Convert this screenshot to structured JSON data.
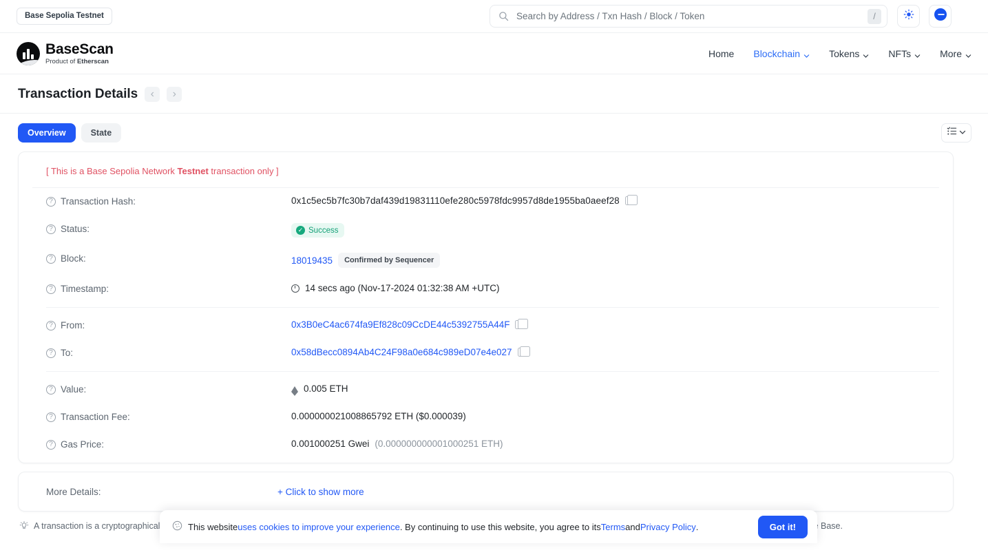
{
  "topbar": {
    "network_pill": "Base Sepolia Testnet",
    "search_placeholder": "Search by Address / Txn Hash / Block / Token",
    "search_value": "",
    "slash_key": "/",
    "theme_icon": "sun-icon",
    "chain_icon": "base-chain-icon"
  },
  "brand": {
    "title": "BaseScan",
    "subtitle_prefix": "Product of ",
    "subtitle_strong": "Etherscan"
  },
  "nav": {
    "items": [
      {
        "label": "Home",
        "has_caret": false,
        "active": false
      },
      {
        "label": "Blockchain",
        "has_caret": true,
        "active": true
      },
      {
        "label": "Tokens",
        "has_caret": true,
        "active": false
      },
      {
        "label": "NFTs",
        "has_caret": true,
        "active": false
      },
      {
        "label": "More",
        "has_caret": true,
        "active": false
      }
    ]
  },
  "page": {
    "title": "Transaction Details",
    "prev_arrow": "‹",
    "next_arrow": "›"
  },
  "tabs": {
    "overview": "Overview",
    "state": "State"
  },
  "card": {
    "testnet_note_pre": "[ This is a Base Sepolia Network ",
    "testnet_note_strong": "Testnet",
    "testnet_note_post": " transaction only ]",
    "rows": {
      "tx_hash_label": "Transaction Hash:",
      "tx_hash_value": "0x1c5ec5b7fc30b7daf439d19831110efe280c5978fdc9957d8de1955ba0aeef28",
      "status_label": "Status:",
      "status_value": "Success",
      "block_label": "Block:",
      "block_value": "18019435",
      "block_badge": "Confirmed by Sequencer",
      "timestamp_label": "Timestamp:",
      "timestamp_value": "14 secs ago (Nov-17-2024 01:32:38 AM +UTC)",
      "from_label": "From:",
      "from_value": "0x3B0eC4ac674fa9Ef828c09CcDE44c5392755A44F",
      "to_label": "To:",
      "to_value": "0x58dBecc0894Ab4C24F98a0e684c989eD07e4e027",
      "value_label": "Value:",
      "value_value": "0.005 ETH",
      "fee_label": "Transaction Fee:",
      "fee_value": "0.000000021008865792 ETH ($0.000039)",
      "gas_label": "Gas Price:",
      "gas_value": "0.001000251 Gwei",
      "gas_value_eth": "(0.000000000001000251 ETH)"
    }
  },
  "more_details": {
    "label": "More Details:",
    "show_more": "+ Click to show more"
  },
  "footnote": {
    "text": "A transaction is a cryptographically signed instruction that changes the blockchain state. Block explorers track the details of all transactions in the blockchain. Learn more about transactions in our Knowledge Base."
  },
  "cookie": {
    "text_1": "This website ",
    "link_1": "uses cookies to improve your experience",
    "text_2": ". By continuing to use this website, you agree to its ",
    "link_2": "Terms",
    "text_3": " and ",
    "link_3": "Privacy Policy",
    "text_4": ".",
    "button": "Got it!"
  },
  "colors": {
    "accent_blue": "#2158f5",
    "success_green": "#14a077",
    "testnet_red": "#e05263"
  }
}
